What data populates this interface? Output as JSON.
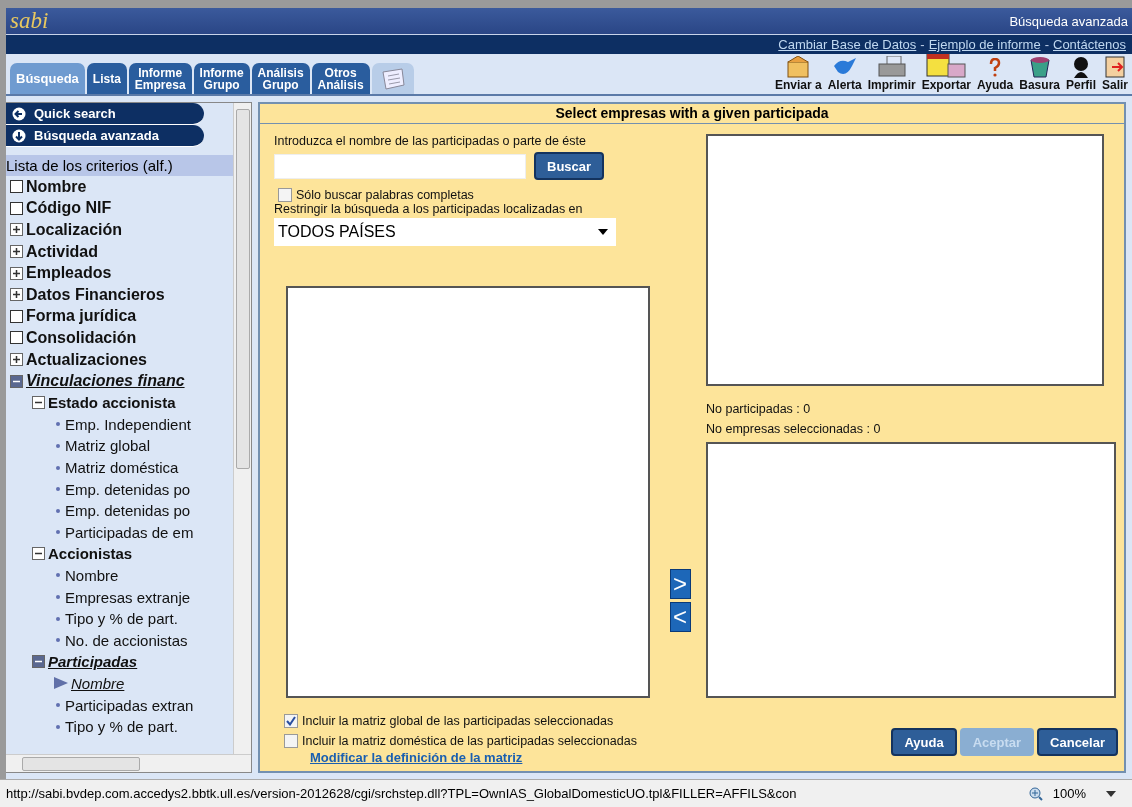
{
  "header": {
    "logo": "sabi",
    "title": "Búsqueda avanzada"
  },
  "links": {
    "items": [
      "Cambiar Base de Datos",
      "Ejemplo de informe",
      "Contáctenos"
    ],
    "separator": "-"
  },
  "tabs": [
    {
      "kind": "text",
      "lines": [
        "Búsqueda"
      ],
      "selected": true
    },
    {
      "kind": "text",
      "lines": [
        "Lista"
      ],
      "selected": false
    },
    {
      "kind": "text",
      "lines": [
        "Informe",
        "Empresa"
      ],
      "selected": false
    },
    {
      "kind": "text",
      "lines": [
        "Informe",
        "Grupo"
      ],
      "selected": false
    },
    {
      "kind": "text",
      "lines": [
        "Análisis",
        "Grupo"
      ],
      "selected": false
    },
    {
      "kind": "text",
      "lines": [
        "Otros",
        "Análisis"
      ],
      "selected": false
    },
    {
      "kind": "icon",
      "selected": false
    }
  ],
  "toolbar": [
    {
      "label": "Enviar a",
      "kind": "envelope"
    },
    {
      "label": "Alerta",
      "kind": "bird"
    },
    {
      "label": "Imprimir",
      "kind": "printer"
    },
    {
      "label": "Exportar",
      "kind": "table"
    },
    {
      "label": "Ayuda",
      "kind": "question"
    },
    {
      "label": "Basura",
      "kind": "bin"
    },
    {
      "label": "Perfil",
      "kind": "person"
    },
    {
      "label": "Salir",
      "kind": "exit"
    }
  ],
  "sidebar": {
    "nav": [
      {
        "label": "Quick search",
        "kind": "left"
      },
      {
        "label": "Búsqueda avanzada",
        "kind": "down"
      }
    ],
    "list_title": "Lista de los criterios (alf.)",
    "tree": [
      {
        "kind": "box",
        "label": "Nombre",
        "checked": false,
        "selected": false
      },
      {
        "kind": "box",
        "label": "Código NIF",
        "checked": false,
        "selected": false
      },
      {
        "kind": "group",
        "label": "Localización",
        "expanded": false,
        "selected": false
      },
      {
        "kind": "group",
        "label": "Actividad",
        "expanded": false,
        "selected": false
      },
      {
        "kind": "group",
        "label": "Empleados",
        "expanded": false,
        "selected": false
      },
      {
        "kind": "group",
        "label": "Datos Financieros",
        "expanded": false,
        "selected": false
      },
      {
        "kind": "box",
        "label": "Forma jurídica",
        "checked": false,
        "selected": false
      },
      {
        "kind": "box",
        "label": "Consolidación",
        "checked": false,
        "selected": false
      },
      {
        "kind": "group",
        "label": "Actualizaciones",
        "expanded": false,
        "selected": false
      },
      {
        "kind": "group",
        "label": "Vinculaciones financ",
        "expanded": true,
        "selected": true,
        "children": [
          {
            "kind": "group",
            "label": "Estado accionista",
            "expanded": true,
            "selected": false,
            "children": [
              {
                "kind": "leaf",
                "label": "Emp. Independient",
                "selected": false
              },
              {
                "kind": "leaf",
                "label": "Matriz global",
                "selected": false
              },
              {
                "kind": "leaf",
                "label": "Matriz doméstica",
                "selected": false
              },
              {
                "kind": "leaf",
                "label": "Emp. detenidas po",
                "selected": false
              },
              {
                "kind": "leaf",
                "label": "Emp. detenidas po",
                "selected": false
              },
              {
                "kind": "leaf",
                "label": "Participadas de em",
                "selected": false
              }
            ]
          },
          {
            "kind": "group",
            "label": "Accionistas",
            "expanded": true,
            "selected": false,
            "children": [
              {
                "kind": "leaf",
                "label": "Nombre",
                "selected": false
              },
              {
                "kind": "leaf",
                "label": "Empresas extranje",
                "selected": false
              },
              {
                "kind": "leaf",
                "label": "Tipo y % de part.",
                "selected": false
              },
              {
                "kind": "leaf",
                "label": "No. de accionistas",
                "selected": false
              }
            ]
          },
          {
            "kind": "group",
            "label": "Participadas",
            "expanded": true,
            "selected": true,
            "children": [
              {
                "kind": "leaf",
                "label": "Nombre",
                "selected": true
              },
              {
                "kind": "leaf",
                "label": "Participadas extran",
                "selected": false
              },
              {
                "kind": "leaf",
                "label": "Tipo y % de part.",
                "selected": false
              }
            ]
          }
        ]
      }
    ]
  },
  "panel": {
    "title": "Select empresas with a given participada",
    "search_label": "Introduzca el nombre de las participadas o parte de éste",
    "search_button": "Buscar",
    "whole_words": {
      "label": "Sólo buscar palabras completas",
      "checked": false
    },
    "restrict_label": "Restringir la búsqueda a los participadas localizadas en",
    "country_select": {
      "value": "TODOS PAÍSES"
    },
    "counts": [
      "No participadas : 0",
      "No empresas seleccionadas : 0"
    ],
    "move_buttons": [
      ">",
      "<"
    ],
    "options": [
      {
        "label": "Incluir la matriz global de las participadas seleccionadas",
        "checked": true
      },
      {
        "label": "Incluir la matriz doméstica de las participadas seleccionadas",
        "checked": false
      }
    ],
    "link": "Modificar la definición de la matriz",
    "buttons": [
      {
        "label": "Ayuda",
        "disabled": false
      },
      {
        "label": "Aceptar",
        "disabled": true
      },
      {
        "label": "Cancelar",
        "disabled": false
      }
    ]
  },
  "status_bar": {
    "url": "http://sabi.bvdep.com.accedys2.bbtk.ull.es/version-2012628/cgi/srchstep.dll?TPL=OwnIAS_GlobalDomesticUO.tpl&FILLER=AFFILS&con",
    "zoom": "100%"
  }
}
